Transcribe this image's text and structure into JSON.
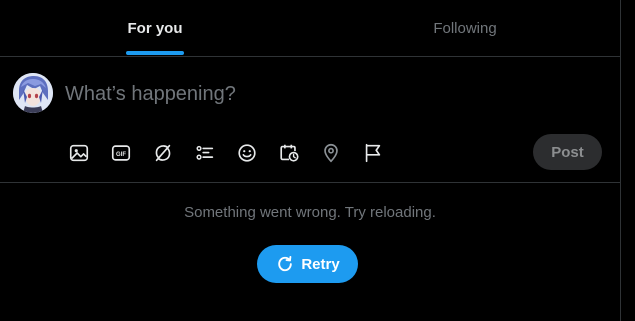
{
  "tabs": [
    {
      "label": "For you",
      "active": true
    },
    {
      "label": "Following",
      "active": false
    }
  ],
  "composer": {
    "placeholder": "What’s happening?",
    "value": "",
    "avatar_icon": "user-avatar-anime",
    "toolbar_icons": [
      "media-icon",
      "gif-icon",
      "grok-icon",
      "poll-icon",
      "emoji-icon",
      "schedule-icon",
      "location-icon",
      "flag-icon"
    ],
    "post_label": "Post"
  },
  "error": {
    "message": "Something went wrong. Try reloading.",
    "retry_label": "Retry",
    "retry_icon": "refresh-icon"
  },
  "colors": {
    "accent": "#1d9bf0",
    "background": "#000000",
    "border": "#2f3336",
    "secondary_text": "#71767b",
    "primary_text": "#e7e9ea",
    "post_disabled_bg": "#2c2d2f"
  }
}
